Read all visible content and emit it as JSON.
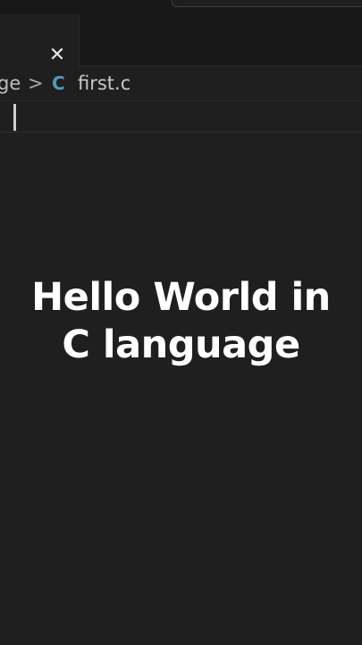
{
  "tab": {
    "close_glyph": "✕"
  },
  "breadcrumb": {
    "parent_fragment": "ge",
    "separator": ">",
    "file_icon_letter": "C",
    "file_name": "first.c"
  },
  "caption": {
    "line1": "Hello World in",
    "line2": "C language"
  },
  "colors": {
    "background": "#1f1f1f",
    "c_icon": "#519aba",
    "caption_text": "#ffffff"
  }
}
